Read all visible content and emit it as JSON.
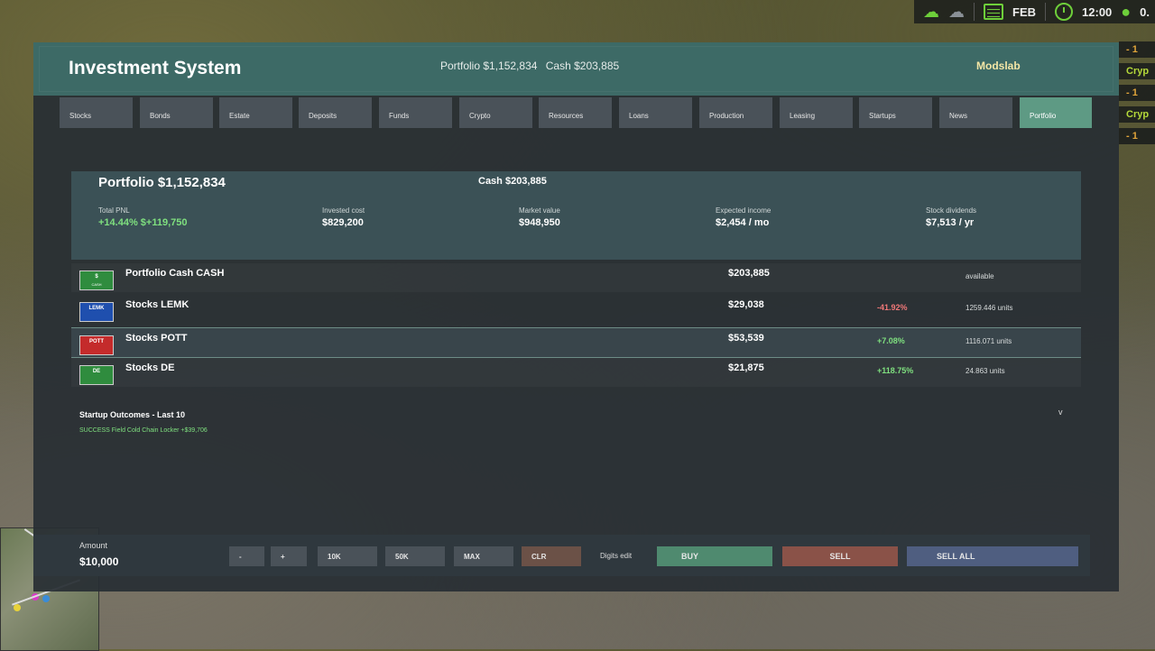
{
  "hud": {
    "month": "FEB",
    "time": "12:00",
    "extra": "0."
  },
  "side_strip": [
    "- 1",
    "Cryp",
    "- 1",
    "Cryp",
    "- 1"
  ],
  "app": {
    "title": "Investment System",
    "brand": "Modslab"
  },
  "title_summary": {
    "portfolio": "Portfolio $1,152,834",
    "cash": "Cash $203,885"
  },
  "tabs": [
    {
      "label": "Stocks"
    },
    {
      "label": "Bonds"
    },
    {
      "label": "Estate"
    },
    {
      "label": "Deposits"
    },
    {
      "label": "Funds"
    },
    {
      "label": "Crypto"
    },
    {
      "label": "Resources"
    },
    {
      "label": "Loans"
    },
    {
      "label": "Production"
    },
    {
      "label": "Leasing"
    },
    {
      "label": "Startups"
    },
    {
      "label": "News"
    },
    {
      "label": "Portfolio"
    }
  ],
  "active_tab": "Portfolio",
  "summary": {
    "title": "Portfolio $1,152,834",
    "cash": "Cash $203,885",
    "total_pnl": {
      "label": "Total PNL",
      "value": "+14.44%  $+119,750"
    },
    "invested_cost": {
      "label": "Invested cost",
      "value": "$829,200"
    },
    "market_value": {
      "label": "Market value",
      "value": "$948,950"
    },
    "expected_income": {
      "label": "Expected income",
      "value": "$2,454 / mo"
    },
    "stock_dividends": {
      "label": "Stock dividends",
      "value": "$7,513 / yr"
    }
  },
  "holdings": [
    {
      "logo": "$",
      "logo_sub": "CASH",
      "logo_color": "#2f8c3e",
      "name": "Portfolio Cash  CASH",
      "value": "$203,885",
      "change": "",
      "units": "available"
    },
    {
      "logo": "LEMK",
      "logo_sub": "",
      "logo_color": "#1f4fae",
      "name": "Stocks  LEMK",
      "value": "$29,038",
      "change": "-41.92%",
      "units": "1259.446 units"
    },
    {
      "logo": "POTT",
      "logo_sub": "",
      "logo_color": "#c42b2b",
      "name": "Stocks  POTT",
      "value": "$53,539",
      "change": "+7.08%",
      "units": "1116.071 units"
    },
    {
      "logo": "DE",
      "logo_sub": "",
      "logo_color": "#2f8c3e",
      "name": "Stocks  DE",
      "value": "$21,875",
      "change": "+118.75%",
      "units": "24.863 units"
    }
  ],
  "outcomes": {
    "title": "Startup Outcomes - Last 10",
    "expand": "v",
    "items": [
      "SUCCESS  Field Cold Chain Locker  +$39,706"
    ]
  },
  "bottom": {
    "amount_label": "Amount",
    "amount_value": "$10,000",
    "minus": "-",
    "plus": "+",
    "k10": "10K",
    "k50": "50K",
    "max": "MAX",
    "clr": "CLR",
    "digits_edit": "Digits edit",
    "buy": "BUY",
    "sell": "SELL",
    "sell_all": "SELL ALL"
  },
  "colors": {
    "titlebar": "#3d6a66",
    "active_tab": "#5e9a84",
    "positive": "#7fe07f",
    "negative": "#f07878",
    "brand": "#f3e6a6"
  }
}
